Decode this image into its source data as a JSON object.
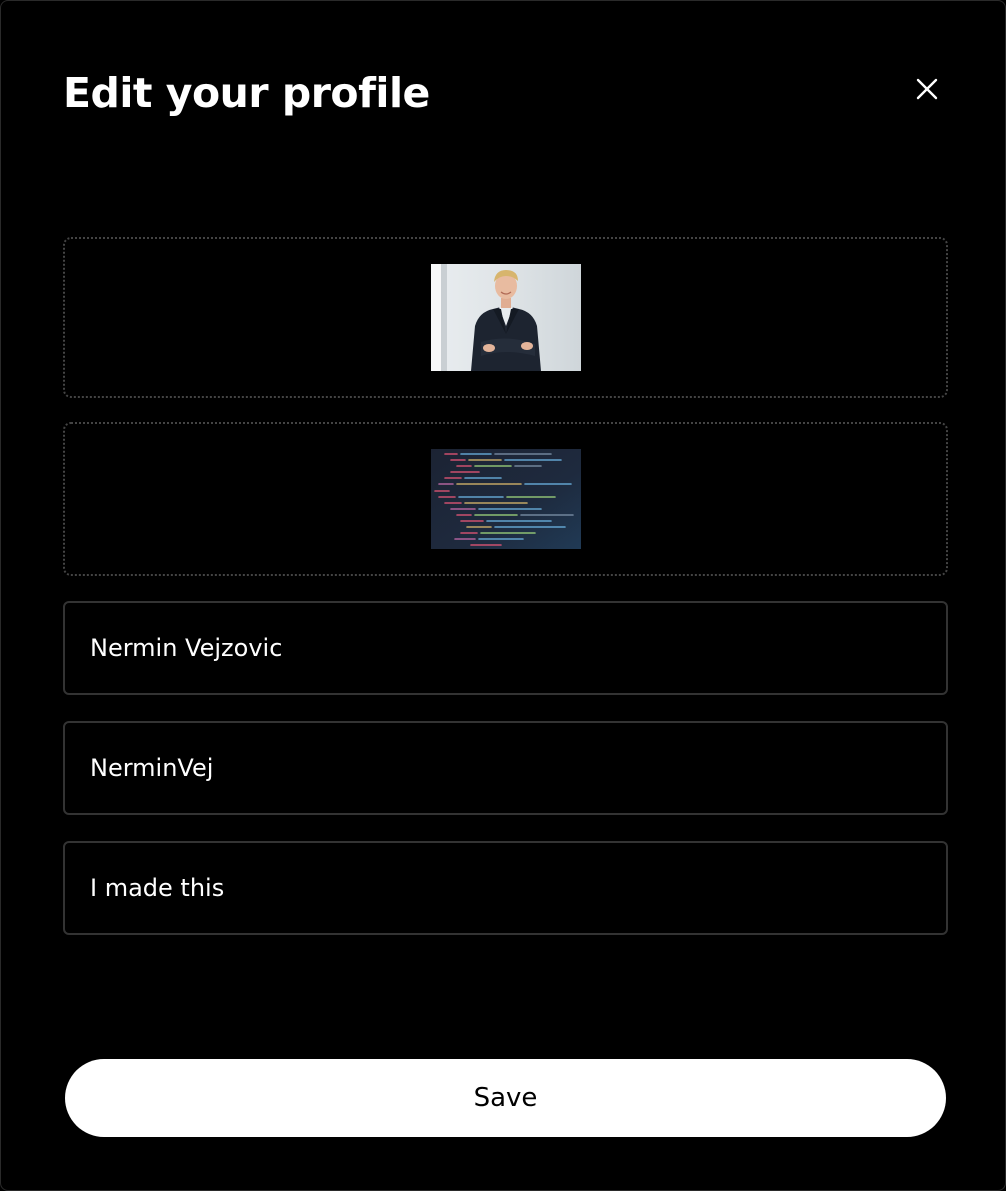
{
  "modal": {
    "title": "Edit your profile",
    "close_icon": "close-icon"
  },
  "images": {
    "avatar_alt": "",
    "banner_alt": ""
  },
  "fields": {
    "name_value": "Nermin Vejzovic",
    "handle_value": "NerminVej",
    "bio_value": "I made this"
  },
  "actions": {
    "save_label": "Save"
  },
  "colors": {
    "background": "#000000",
    "button_bg": "#ffffff",
    "border": "#333333"
  }
}
